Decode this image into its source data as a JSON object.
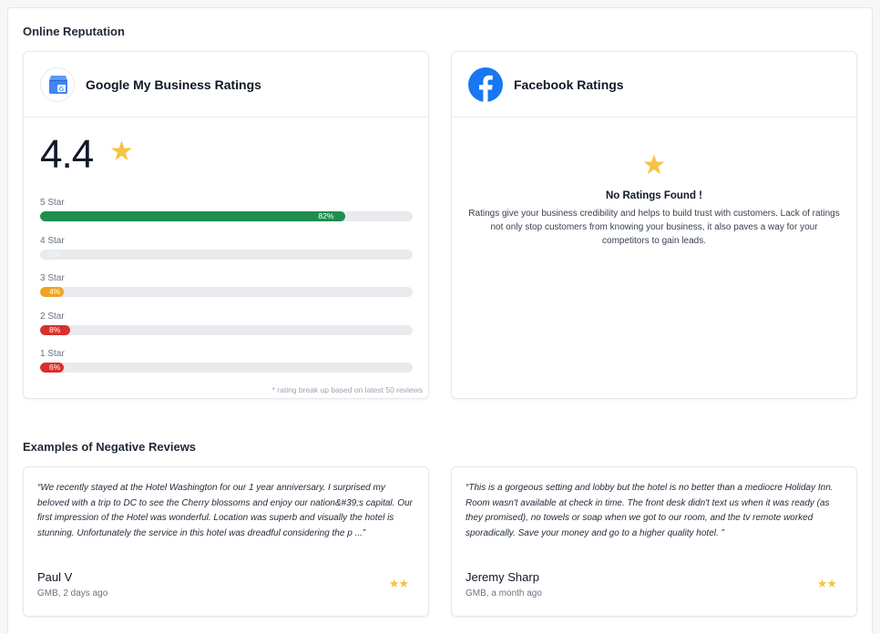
{
  "online_reputation": {
    "title": "Online Reputation",
    "gmb": {
      "title": "Google My Business Ratings",
      "logo_icon": "google-my-business-icon",
      "rating": "4.4",
      "bars": [
        {
          "label": "5 Star",
          "percent": 82,
          "pct_text": "82%",
          "color": "#1e8e4e"
        },
        {
          "label": "4 Star",
          "percent": 0,
          "pct_text": "0%",
          "color": "#cfd2d6"
        },
        {
          "label": "3 Star",
          "percent": 4,
          "pct_text": "4%",
          "color": "#f0a422"
        },
        {
          "label": "2 Star",
          "percent": 8,
          "pct_text": "8%",
          "color": "#d9302b"
        },
        {
          "label": "1 Star",
          "percent": 6,
          "pct_text": "6%",
          "color": "#d9302b"
        }
      ],
      "footnote": "* rating break up based on latest 50 reviews"
    },
    "facebook": {
      "title": "Facebook Ratings",
      "logo_icon": "facebook-icon",
      "empty_title": "No Ratings Found !",
      "empty_text": "Ratings give your business credibility and helps to build trust with customers. Lack of ratings not only stop customers from knowing your business, it also paves a way for your competitors to gain leads."
    }
  },
  "negative_reviews": {
    "title": "Examples of Negative Reviews",
    "items": [
      {
        "text": "“We recently stayed at the Hotel Washington for our 1 year anniversary. I surprised my beloved with a trip to DC to see the Cherry blossoms and enjoy our nation&#39;s capital. Our first impression of the Hotel was wonderful. Location was superb and visually the hotel is stunning. Unfortunately the service in this hotel was dreadful considering the p ...”",
        "author": "Paul V",
        "meta": "GMB, 2 days ago",
        "stars": 2
      },
      {
        "text": "“This is a gorgeous setting and lobby but the hotel is no better than a mediocre Holiday Inn. Room wasn't available at check in time. The front desk didn't text us when it was ready (as they promised), no towels or soap when we got to our room, and the tv remote worked sporadically. Save your money and go to a higher quality hotel. ”",
        "author": "Jeremy Sharp",
        "meta": "GMB, a month ago",
        "stars": 2
      }
    ]
  }
}
